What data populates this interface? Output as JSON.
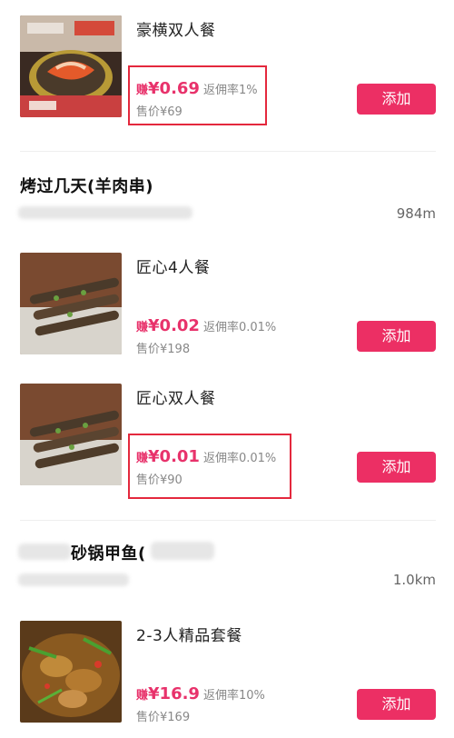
{
  "store1": {
    "products": [
      {
        "name": "豪横双人餐",
        "earn_prefix": "赚",
        "earn": "¥0.69",
        "rate": "返佣率1%",
        "price": "售价¥69",
        "button": "添加"
      }
    ]
  },
  "store2": {
    "name": "烤过几天(羊肉串)",
    "distance": "984m",
    "products": [
      {
        "name": "匠心4人餐",
        "earn_prefix": "赚",
        "earn": "¥0.02",
        "rate": "返佣率0.01%",
        "price": "售价¥198",
        "button": "添加"
      },
      {
        "name": "匠心双人餐",
        "earn_prefix": "赚",
        "earn": "¥0.01",
        "rate": "返佣率0.01%",
        "price": "售价¥90",
        "button": "添加"
      }
    ]
  },
  "store3": {
    "name_visible": "砂锅甲鱼(",
    "distance": "1.0km",
    "products": [
      {
        "name": "2-3人精品套餐",
        "earn_prefix": "赚",
        "earn": "¥16.9",
        "rate": "返佣率10%",
        "price": "售价¥169",
        "button": "添加"
      }
    ]
  },
  "colors": {
    "accent": "#ec2f64",
    "earn": "#e8326b",
    "highlight_box": "#e4283d"
  }
}
